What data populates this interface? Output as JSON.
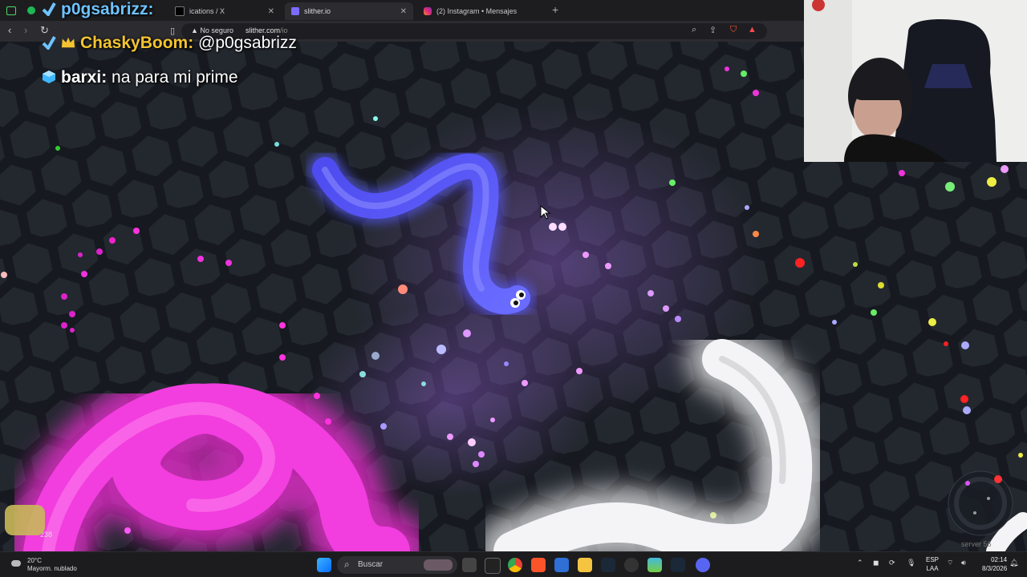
{
  "browser": {
    "tabs": [
      {
        "label": "...",
        "active": false
      },
      {
        "label": "ications / X",
        "active": false
      },
      {
        "label": "slither.io",
        "active": true
      },
      {
        "label": "(2) Instagram • Mensajes",
        "active": false
      }
    ],
    "security_label": "No seguro",
    "url_host": "slither.com",
    "url_path": "/io"
  },
  "chat": [
    {
      "user": "p0gsabrizz:",
      "message": "",
      "color": "#6ec3ff"
    },
    {
      "user": "ChaskyBoom:",
      "message": " @p0gsabrizz",
      "color": "#f4c430"
    },
    {
      "user": "barxi:",
      "message": " na para mi prime",
      "color": "#ffffff"
    }
  ],
  "game": {
    "server_label": "server 56",
    "length_hint": "238",
    "accent": "#5b5cff"
  },
  "taskbar": {
    "weather_temp": "20°C",
    "weather_desc": "Mayorm. nublado",
    "search_label": "Buscar",
    "lang_line1": "ESP",
    "lang_line2": "LAA",
    "time": "02:14",
    "date": "8/3/2026"
  },
  "icons": {
    "back": "back-arrow-icon",
    "forward": "forward-arrow-icon",
    "reload": "reload-icon",
    "bookmark": "bookmark-icon",
    "zoom": "zoom-icon",
    "share": "share-icon"
  }
}
